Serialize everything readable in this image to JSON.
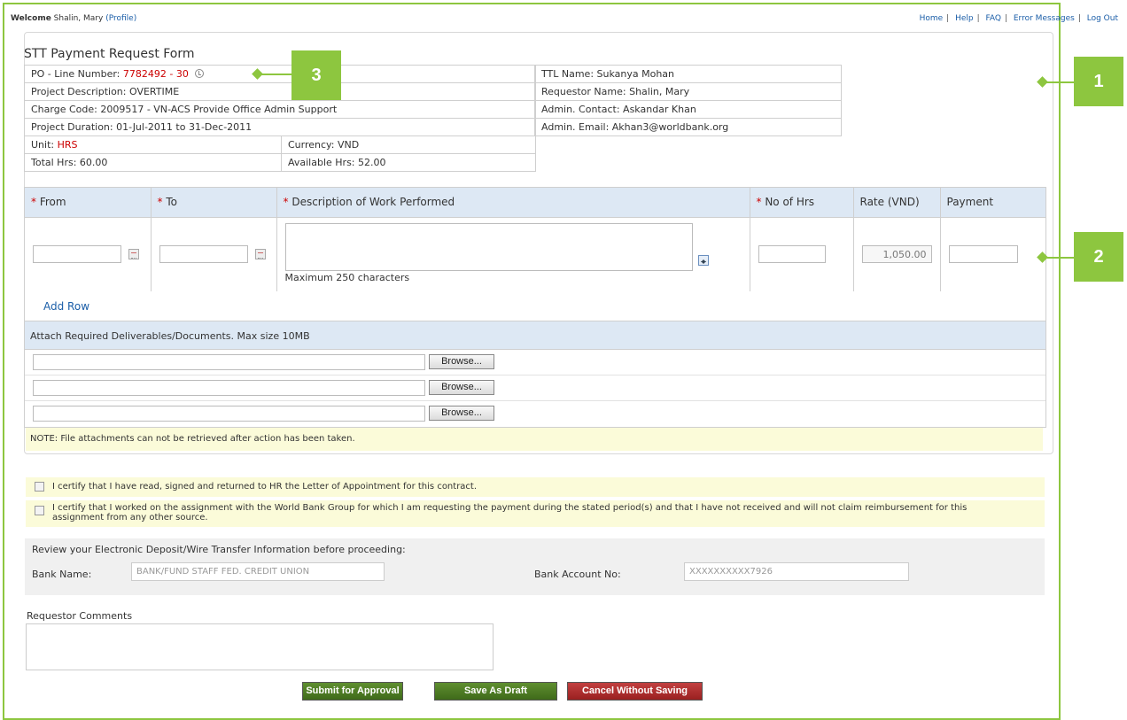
{
  "header": {
    "welcome": "Welcome",
    "user": "Shalin, Mary",
    "profile_link": "(Profile)",
    "nav": [
      "Home",
      "Help",
      "FAQ",
      "Error Messages",
      "Log Out"
    ]
  },
  "form": {
    "title": "STT Payment Request Form",
    "po_label": "PO - Line Number:",
    "po_value": "7782492 - 30",
    "project_description": "Project Description: OVERTIME",
    "charge_code": "Charge Code: 2009517 - VN-ACS Provide Office Admin Support",
    "project_duration": "Project Duration: 01-Jul-2011 to 31-Dec-2011",
    "unit_label": "Unit:",
    "unit_value": "HRS",
    "currency": "Currency: VND",
    "total_hrs": "Total Hrs: 60.00",
    "available_hrs": "Available Hrs: 52.00",
    "ttl_name": "TTL Name: Sukanya Mohan",
    "requestor_name": "Requestor Name: Shalin, Mary",
    "admin_contact": "Admin. Contact: Askandar Khan",
    "admin_email": "Admin. Email: Akhan3@worldbank.org"
  },
  "work_table": {
    "required_mark": "*",
    "headers": {
      "from": "From",
      "to": "To",
      "description": "Description of Work Performed",
      "hours": "No of Hrs",
      "rate": "Rate (VND)",
      "payment": "Payment"
    },
    "rate_value": "1,050.00",
    "max_chars": "Maximum 250 characters",
    "add_row": "Add Row"
  },
  "attachments": {
    "heading": "Attach Required Deliverables/Documents. Max size 10MB",
    "browse_label": "Browse...",
    "note": "NOTE: File attachments can not be retrieved after action has been taken."
  },
  "certifications": {
    "cert1": "I certify that I have read, signed and returned to HR the Letter of Appointment for this contract.",
    "cert2_line1": "I certify that I worked on the assignment with the World Bank Group for which I am requesting the payment during the stated period(s) and that I have not received and will not claim reimbursement for this",
    "cert2_line2": "assignment from any other source."
  },
  "bank": {
    "review_text": "Review your Electronic Deposit/Wire Transfer Information before proceeding:",
    "bank_name_label": "Bank Name:",
    "bank_name_value": "BANK/FUND STAFF FED. CREDIT UNION",
    "account_label": "Bank Account No:",
    "account_value": "XXXXXXXXXX7926"
  },
  "comments": {
    "label": "Requestor Comments"
  },
  "buttons": {
    "submit": "Submit for Approval",
    "draft": "Save As Draft",
    "cancel": "Cancel Without Saving"
  },
  "callouts": {
    "c1": "1",
    "c2": "2",
    "c3": "3"
  },
  "colors": {
    "callout": "#8dc63f",
    "link": "#1b5ea8",
    "required": "#cc0000",
    "header_bg": "#dde8f4",
    "note_bg": "#fbfbd9"
  }
}
